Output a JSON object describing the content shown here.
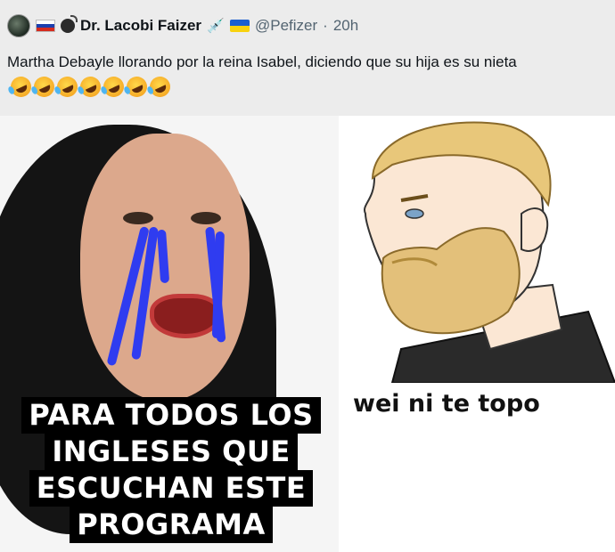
{
  "tweet": {
    "display_name": "Dr. Lacobi Faizer",
    "handle": "@Pefizer",
    "separator": "·",
    "time": "20h",
    "text": "Martha Debayle llorando por la reina Isabel, diciendo que su hija es su nieta",
    "emoji_count": 7,
    "emoji_icon": "face-with-tears-of-joy-rotated-icon"
  },
  "meme": {
    "left_caption": [
      "PARA TODOS LOS",
      "INGLESES QUE",
      "ESCUCHAN ESTE",
      "PROGRAMA"
    ],
    "right_caption": "wei ni te topo"
  },
  "colors": {
    "header_bg": "#ececec",
    "tear_blue": "#2f3cf0",
    "caption_bg": "#000000",
    "caption_text": "#ffffff"
  }
}
